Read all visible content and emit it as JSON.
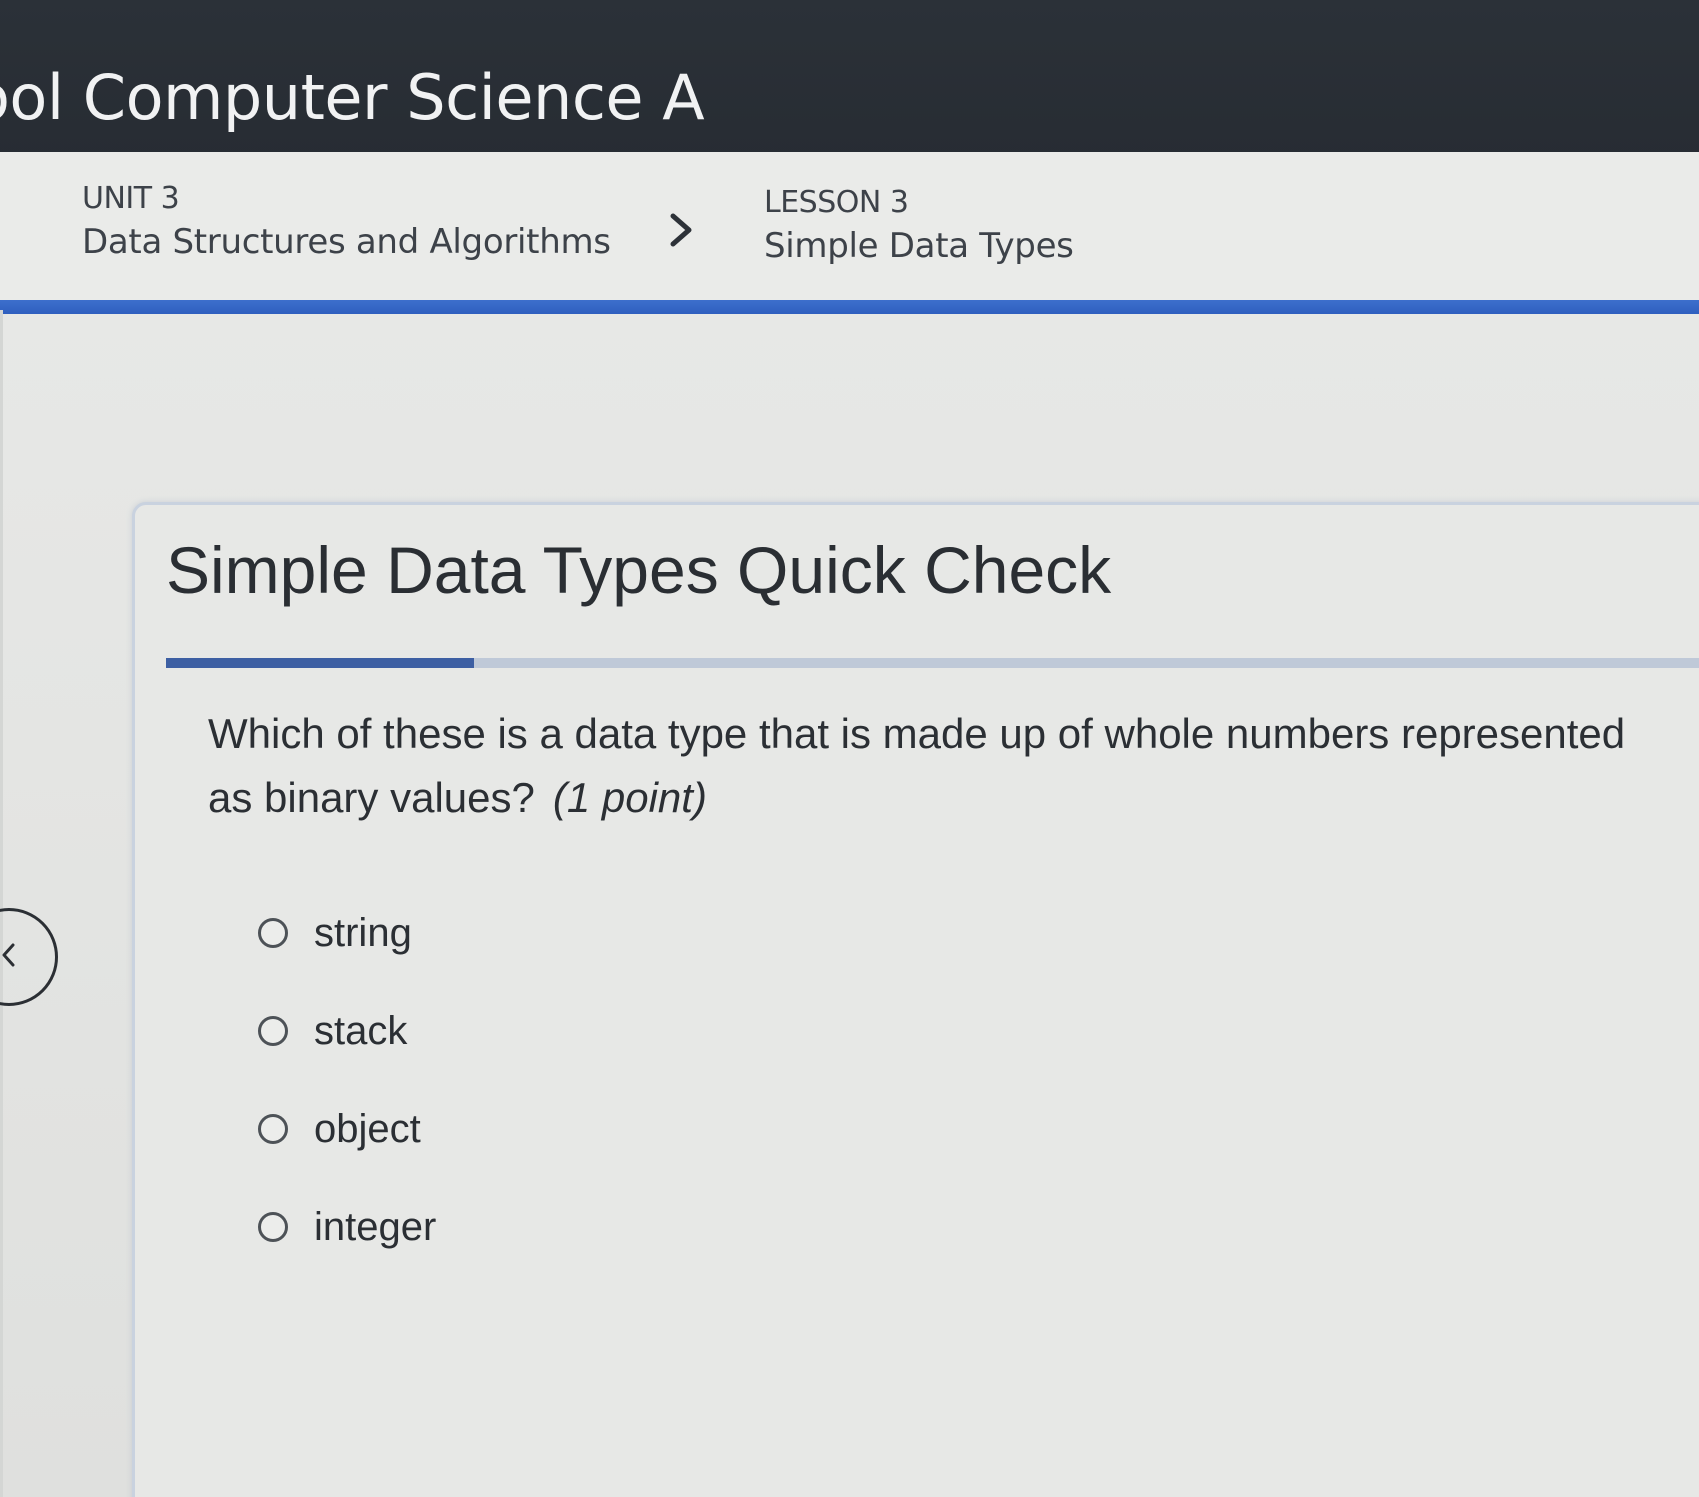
{
  "header": {
    "course_title": "ool Computer Science A"
  },
  "breadcrumb": {
    "unit_label": "UNIT 3",
    "unit_name": "Data Structures and Algorithms",
    "lesson_label": "LESSON 3",
    "lesson_name": "Simple Data Types"
  },
  "quiz": {
    "title": "Simple Data Types Quick Check",
    "progress_fraction": 0.2,
    "question": "Which of these is a data type that is made up of whole numbers represented as binary values?",
    "points": "(1 point)",
    "options": [
      "string",
      "stack",
      "object",
      "integer"
    ]
  },
  "colors": {
    "header_bg": "#2b3138",
    "accent_blue": "#2f5fbf",
    "progress_fill": "#3d5fa3"
  }
}
